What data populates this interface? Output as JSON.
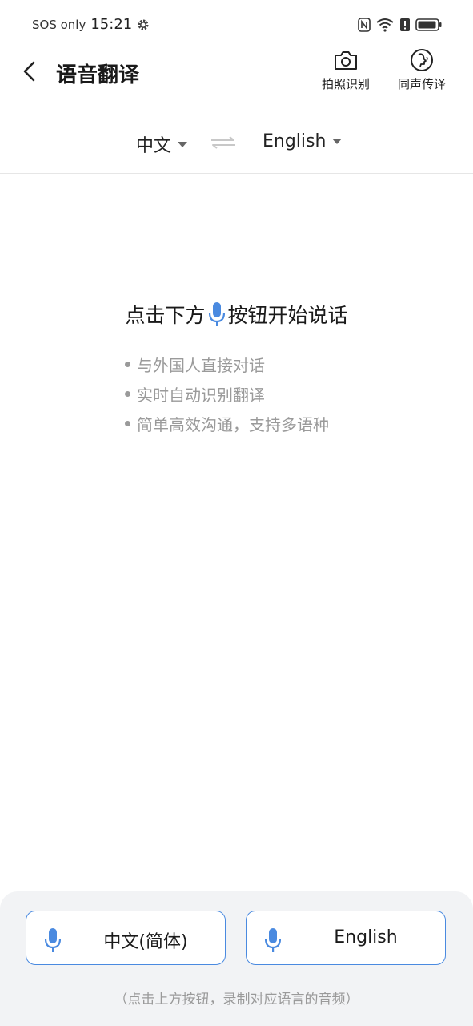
{
  "status_bar": {
    "carrier": "SOS only",
    "time": "15:21",
    "icons": [
      "gear-icon",
      "nfc-icon",
      "wifi-icon",
      "alert-icon",
      "battery-icon"
    ]
  },
  "header": {
    "title": "语音翻译",
    "photo_label": "拍照识别",
    "simultaneous_label": "同声传译"
  },
  "language_bar": {
    "source": "中文",
    "target": "English"
  },
  "guide": {
    "title_before": "点击下方",
    "title_after": "按钮开始说话",
    "tips": [
      "与外国人直接对话",
      "实时自动识别翻译",
      "简单高效沟通，支持多语种"
    ]
  },
  "bottom": {
    "left_button": "中文(简体)",
    "right_button": "English",
    "hint": "（点击上方按钮，录制对应语言的音频）"
  },
  "colors": {
    "accent": "#4a8ae0",
    "muted_text": "#9a9a9a",
    "panel_bg": "#f2f3f5"
  }
}
